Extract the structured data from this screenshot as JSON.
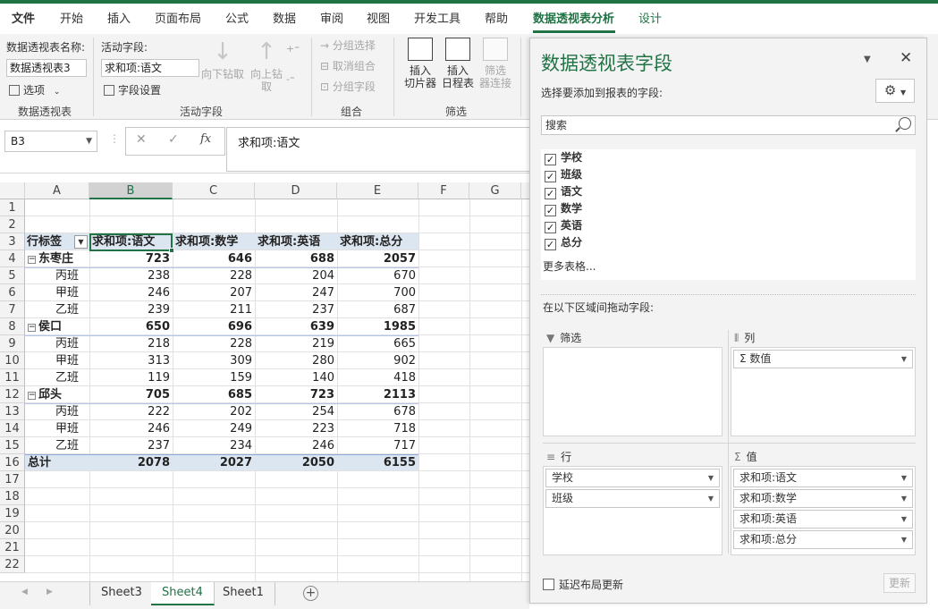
{
  "ribbon_tabs": [
    "文件",
    "开始",
    "插入",
    "页面布局",
    "公式",
    "数据",
    "审阅",
    "视图",
    "开发工具",
    "帮助",
    "数据透视表分析",
    "设计"
  ],
  "ribbon": {
    "pivot_name_label": "数据透视表名称:",
    "pivot_name_value": "数据透视表3",
    "options_label": "选项",
    "group_pivot": "数据透视表",
    "active_field_label": "活动字段:",
    "active_field_value": "求和项:语文",
    "field_settings": "字段设置",
    "drill_down": "向下钻取",
    "drill_up_1": "向上钻",
    "drill_up_2": "取",
    "group_active_field": "活动字段",
    "group_selection": "分组选择",
    "ungroup": "取消组合",
    "group_field": "分组字段",
    "group_group": "组合",
    "slicer_1": "插入",
    "slicer_2": "切片器",
    "timeline_1": "插入",
    "timeline_2": "日程表",
    "filter_conn_1": "筛选",
    "filter_conn_2": "器连接",
    "group_filter": "筛选"
  },
  "formula_bar": {
    "name_box": "B3",
    "fx": "fx",
    "formula": "求和项:语文"
  },
  "columns": [
    "A",
    "B",
    "C",
    "D",
    "E",
    "F",
    "G"
  ],
  "rows": [
    "1",
    "2",
    "3",
    "4",
    "5",
    "6",
    "7",
    "8",
    "9",
    "10",
    "11",
    "12",
    "13",
    "14",
    "15",
    "16",
    "17",
    "18",
    "19",
    "20",
    "21",
    "22"
  ],
  "pivot": {
    "headers": [
      "行标签",
      "求和项:语文",
      "求和项:数学",
      "求和项:英语",
      "求和项:总分"
    ],
    "body": [
      {
        "label": "东枣庄",
        "group": true,
        "values": [
          "723",
          "646",
          "688",
          "2057"
        ]
      },
      {
        "label": "丙班",
        "group": false,
        "values": [
          "238",
          "228",
          "204",
          "670"
        ]
      },
      {
        "label": "甲班",
        "group": false,
        "values": [
          "246",
          "207",
          "247",
          "700"
        ]
      },
      {
        "label": "乙班",
        "group": false,
        "values": [
          "239",
          "211",
          "237",
          "687"
        ]
      },
      {
        "label": "侯口",
        "group": true,
        "values": [
          "650",
          "696",
          "639",
          "1985"
        ]
      },
      {
        "label": "丙班",
        "group": false,
        "values": [
          "218",
          "228",
          "219",
          "665"
        ]
      },
      {
        "label": "甲班",
        "group": false,
        "values": [
          "313",
          "309",
          "280",
          "902"
        ]
      },
      {
        "label": "乙班",
        "group": false,
        "values": [
          "119",
          "159",
          "140",
          "418"
        ]
      },
      {
        "label": "邱头",
        "group": true,
        "values": [
          "705",
          "685",
          "723",
          "2113"
        ]
      },
      {
        "label": "丙班",
        "group": false,
        "values": [
          "222",
          "202",
          "254",
          "678"
        ]
      },
      {
        "label": "甲班",
        "group": false,
        "values": [
          "246",
          "249",
          "223",
          "718"
        ]
      },
      {
        "label": "乙班",
        "group": false,
        "values": [
          "237",
          "234",
          "246",
          "717"
        ]
      }
    ],
    "total": {
      "label": "总计",
      "values": [
        "2078",
        "2027",
        "2050",
        "6155"
      ]
    }
  },
  "sheets": [
    "Sheet3",
    "Sheet4",
    "Sheet1"
  ],
  "active_sheet": "Sheet4",
  "pane": {
    "title": "数据透视表字段",
    "subtitle": "选择要添加到报表的字段:",
    "search_placeholder": "搜索",
    "fields": [
      "学校",
      "班级",
      "语文",
      "数学",
      "英语",
      "总分"
    ],
    "more_tables": "更多表格...",
    "drag_label": "在以下区域间拖动字段:",
    "filter_area": "筛选",
    "columns_area": "列",
    "rows_area": "行",
    "values_area": "值",
    "column_items": [
      "Σ 数值"
    ],
    "row_items": [
      "学校",
      "班级"
    ],
    "value_items": [
      "求和项:语文",
      "求和项:数学",
      "求和项:英语",
      "求和项:总分"
    ],
    "defer_label": "延迟布局更新",
    "update_label": "更新"
  },
  "colors": {
    "accent": "#217346",
    "pivot_header_bg": "#dce6f1"
  }
}
